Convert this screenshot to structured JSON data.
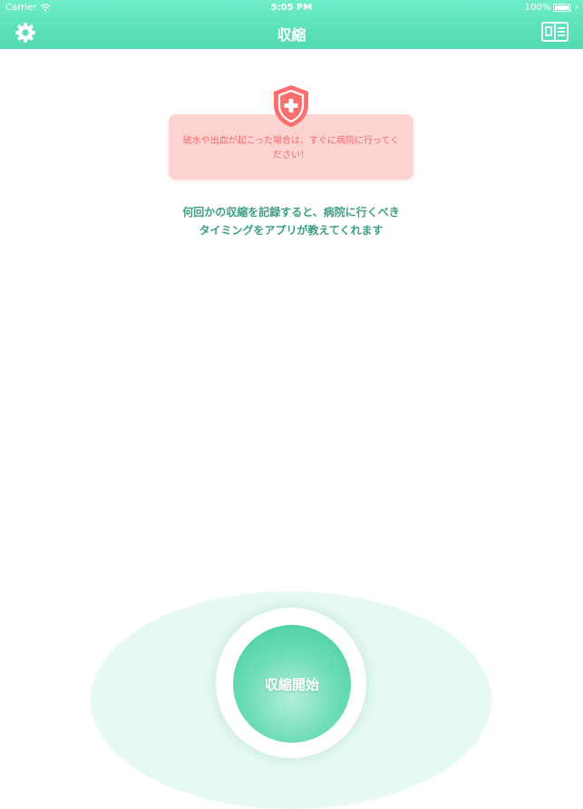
{
  "status_bar": {
    "carrier": "Carrier",
    "time": "5:05 PM",
    "battery": "100%"
  },
  "nav": {
    "title": "収縮"
  },
  "warning": {
    "text": "破水や出血が起こった場合は、すぐに病院に行ってください！"
  },
  "info": {
    "text": "何回かの収縮を記録すると、病院に行くべきタイミングをアプリが教えてくれます"
  },
  "start_button": {
    "label": "収縮開始"
  },
  "colors": {
    "header": "#5fe3bd",
    "warning_bg": "#fdd3d1",
    "warning_text": "#f26b6b",
    "shield": "#fa6e6e",
    "info_text": "#3c9f86",
    "button": "#4fd3a9",
    "ellipse": "#e6faf3"
  },
  "icons": {
    "settings": "gear-icon",
    "guide": "book-icon",
    "warning": "shield-cross-icon",
    "wifi": "wifi-icon",
    "battery": "battery-icon"
  }
}
